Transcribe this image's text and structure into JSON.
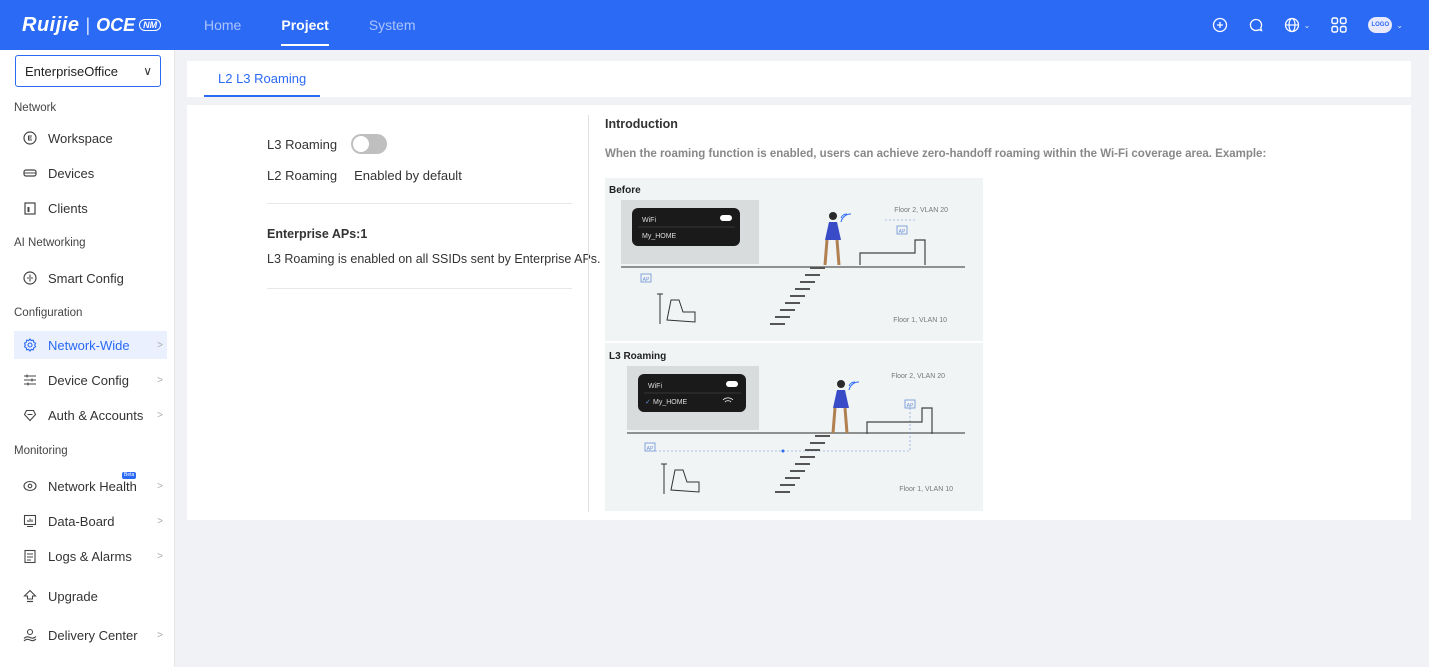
{
  "header": {
    "brand": "Ruijie",
    "separator": "|",
    "product": "OCE",
    "badge": "NM",
    "nav": [
      {
        "label": "Home",
        "active": false
      },
      {
        "label": "Project",
        "active": true
      },
      {
        "label": "System",
        "active": false
      }
    ],
    "avatar_text": "LOGO",
    "icons": [
      "add-circle-icon",
      "chat-icon",
      "globe-icon",
      "apps-grid-icon",
      "avatar"
    ]
  },
  "sidebar": {
    "project": "EnterpriseOffice",
    "groups": [
      {
        "title": "Network",
        "items": [
          {
            "label": "Workspace",
            "icon": "workspace-icon"
          },
          {
            "label": "Devices",
            "icon": "devices-icon"
          },
          {
            "label": "Clients",
            "icon": "clients-icon"
          }
        ]
      },
      {
        "title": "AI Networking",
        "items": [
          {
            "label": "Smart Config",
            "icon": "smart-config-icon"
          }
        ]
      },
      {
        "title": "Configuration",
        "items": [
          {
            "label": "Network-Wide",
            "icon": "gear-icon",
            "active": true
          },
          {
            "label": "Device Config",
            "icon": "sliders-icon"
          },
          {
            "label": "Auth & Accounts",
            "icon": "shield-icon"
          }
        ]
      },
      {
        "title": "Monitoring",
        "items": [
          {
            "label": "Network Health",
            "icon": "health-icon",
            "badge": "Beta"
          },
          {
            "label": "Data-Board",
            "icon": "dashboard-icon"
          },
          {
            "label": "Logs & Alarms",
            "icon": "logs-icon"
          },
          {
            "label": "Upgrade",
            "icon": "upgrade-icon"
          },
          {
            "label": "Delivery Center",
            "icon": "delivery-icon"
          }
        ]
      }
    ]
  },
  "tabs": [
    {
      "label": "L2 L3 Roaming",
      "active": true
    }
  ],
  "settings": {
    "l3_label": "L3 Roaming",
    "l3_enabled": false,
    "l2_label": "L2 Roaming",
    "l2_value": "Enabled by default",
    "enterprise_title": "Enterprise APs:1",
    "enterprise_desc": "L3 Roaming is enabled on all SSIDs sent by Enterprise APs."
  },
  "intro": {
    "title": "Introduction",
    "text": "When the roaming function is enabled, users can achieve zero-handoff roaming within the Wi-Fi coverage area. Example:"
  },
  "diagram": {
    "panels": [
      {
        "title": "Before",
        "wifi_label": "WiFi",
        "ssid": "My_HOME",
        "floor2": "Floor 2, VLAN 20",
        "floor1": "Floor 1, VLAN 10",
        "ap_label": "AP"
      },
      {
        "title": "L3 Roaming",
        "wifi_label": "WiFi",
        "ssid": "My_HOME",
        "floor2": "Floor 2, VLAN 20",
        "floor1": "Floor 1, VLAN 10",
        "ap_label": "AP"
      }
    ]
  }
}
